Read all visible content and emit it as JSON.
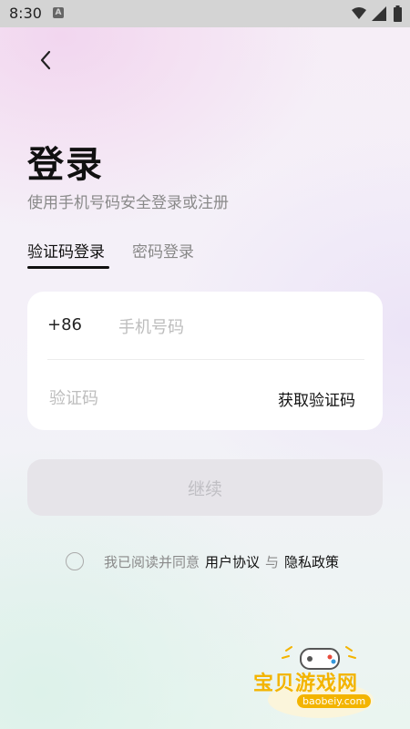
{
  "status_bar": {
    "time": "8:30",
    "notif_glyph": "A",
    "icons": [
      "wifi-icon",
      "signal-icon",
      "battery-icon"
    ]
  },
  "header": {
    "back_icon": "chevron-left-icon"
  },
  "login": {
    "title": "登录",
    "subtitle": "使用手机号码安全登录或注册",
    "tabs": [
      {
        "label": "验证码登录",
        "active": true
      },
      {
        "label": "密码登录",
        "active": false
      }
    ],
    "country_code": "+86",
    "phone_placeholder": "手机号码",
    "code_placeholder": "验证码",
    "get_code_label": "获取验证码",
    "continue_label": "继续",
    "agreement": {
      "prefix": "我已阅读并同意",
      "user_agreement": "用户协议",
      "and": "与",
      "privacy_policy": "隐私政策",
      "checked": false
    }
  },
  "watermark": {
    "title": "宝贝游戏网",
    "url": "baobeiy.com"
  },
  "colors": {
    "accent": "#111111",
    "disabled_button": "#e6e4e9",
    "watermark": "#f3b400"
  }
}
